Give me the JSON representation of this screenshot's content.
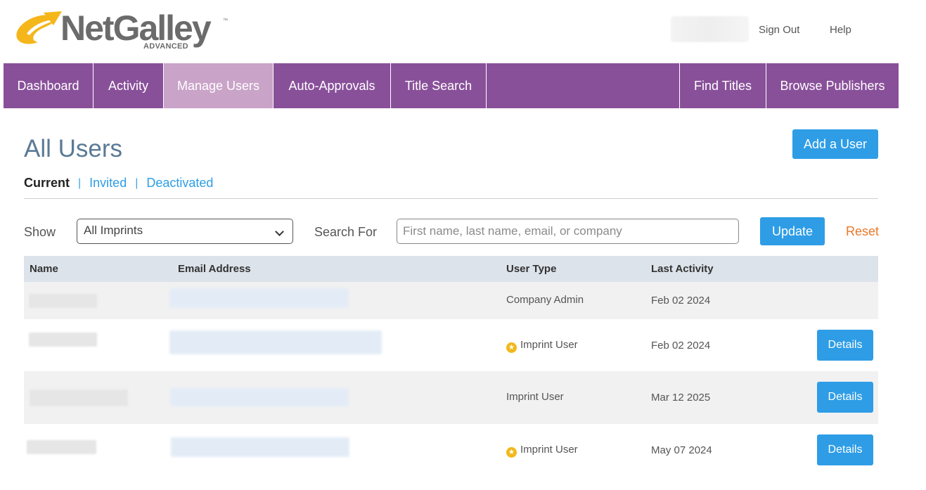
{
  "header": {
    "logo_text": "NetGalley",
    "logo_tm": "™",
    "logo_subtext": "ADVANCED",
    "links": {
      "sign_out": "Sign Out",
      "help": "Help"
    }
  },
  "nav": {
    "items": [
      {
        "label": "Dashboard"
      },
      {
        "label": "Activity"
      },
      {
        "label": "Manage Users",
        "active": true
      },
      {
        "label": "Auto-Approvals"
      },
      {
        "label": "Title Search"
      }
    ],
    "right_items": [
      {
        "label": "Find Titles"
      },
      {
        "label": "Browse Publishers"
      }
    ]
  },
  "main": {
    "title": "All Users",
    "add_user_label": "Add a User",
    "subtabs": {
      "current": "Current",
      "separator": "|",
      "invited": "Invited",
      "deactivated": "Deactivated"
    },
    "filters": {
      "show_label": "Show",
      "imprint_selected": "All Imprints",
      "search_label": "Search For",
      "search_placeholder": "First name, last name, email, or company",
      "update_label": "Update",
      "reset_label": "Reset"
    }
  },
  "table": {
    "columns": [
      "Name",
      "Email Address",
      "User Type",
      "Last Activity"
    ],
    "rows": [
      {
        "user_type": "Company Admin",
        "starred": false,
        "last_activity": "Feb 02 2024",
        "details": ""
      },
      {
        "user_type": "Imprint User",
        "starred": true,
        "last_activity": "Feb 02 2024",
        "details": "Details"
      },
      {
        "user_type": "Imprint User",
        "starred": false,
        "last_activity": "Mar 12 2025",
        "details": "Details"
      },
      {
        "user_type": "Imprint User",
        "starred": true,
        "last_activity": "May 07 2024",
        "details": "Details"
      }
    ]
  },
  "colors": {
    "nav_bg": "#89509a",
    "nav_active": "#c9a3c8",
    "primary_button": "#2e9de6",
    "reset_link": "#e8782a",
    "title": "#5a7a96",
    "star_badge": "#f2b81c"
  },
  "icons": {
    "logo_mark": "netgalley-swoosh-icon",
    "select_chevron": "chevron-down-icon",
    "star_badge": "star-badge-icon"
  }
}
